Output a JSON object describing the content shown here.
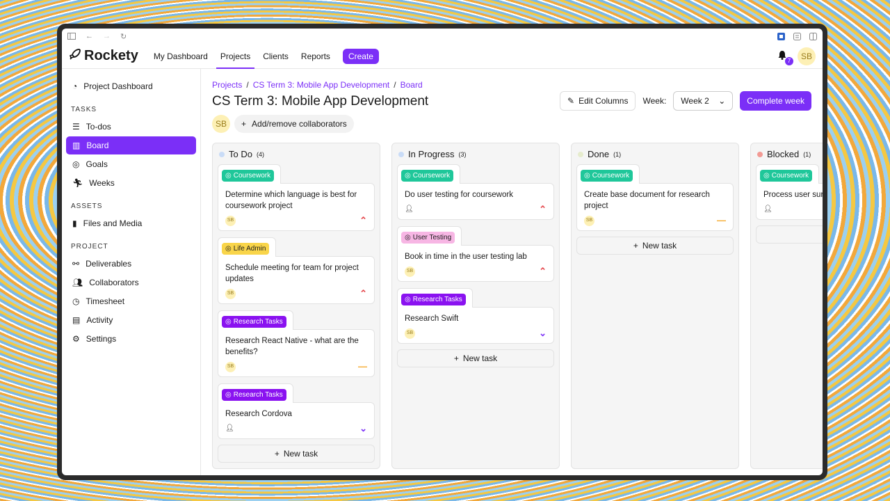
{
  "app": {
    "name": "Rockety"
  },
  "nav": {
    "dashboard": "My Dashboard",
    "projects": "Projects",
    "clients": "Clients",
    "reports": "Reports",
    "create": "Create"
  },
  "notifications": {
    "count": "7"
  },
  "user": {
    "initials": "SB"
  },
  "sidebar": {
    "dashboard": "Project Dashboard",
    "tasks_head": "TASKS",
    "todos": "To-dos",
    "board": "Board",
    "goals": "Goals",
    "weeks": "Weeks",
    "assets_head": "ASSETS",
    "files": "Files and Media",
    "project_head": "PROJECT",
    "deliverables": "Deliverables",
    "collaborators": "Collaborators",
    "timesheet": "Timesheet",
    "activity": "Activity",
    "settings": "Settings"
  },
  "breadcrumb": {
    "c1": "Projects",
    "c2": "CS Term 3: Mobile App Development",
    "c3": "Board",
    "sep": "/"
  },
  "page": {
    "title": "CS Term 3: Mobile App Development"
  },
  "actions": {
    "edit": "Edit Columns",
    "week_label": "Week:",
    "week_value": "Week 2",
    "complete": "Complete week"
  },
  "collab": {
    "add": "Add/remove collaborators"
  },
  "colors": {
    "accent": "#7b2ff7",
    "coursework": "#1fc79a",
    "life": "#f9d54a",
    "research": "#8a12f0",
    "testing": "#f7b6e4"
  },
  "columns": [
    {
      "name": "To Do",
      "count": "(4)",
      "dot": "#c9dcf7",
      "new": "New task",
      "cards": [
        {
          "tag": "Coursework",
          "text": "Determine which language is best for coursework project",
          "av": "SB",
          "prio": "up"
        },
        {
          "tag": "Life Admin",
          "text": "Schedule meeting for team for project updates",
          "av": "SB",
          "prio": "up"
        },
        {
          "tag": "Research Tasks",
          "text": "Research React Native - what are the benefits?",
          "av": "SB",
          "prio": "mid"
        },
        {
          "tag": "Research Tasks",
          "text": "Research Cordova",
          "av": "",
          "prio": "down"
        }
      ]
    },
    {
      "name": "In Progress",
      "count": "(3)",
      "dot": "#c9dcf7",
      "new": "New task",
      "cards": [
        {
          "tag": "Coursework",
          "text": "Do user testing for coursework",
          "av": "",
          "prio": "up"
        },
        {
          "tag": "User Testing",
          "text": "Book in time in the user testing lab",
          "av": "SB",
          "prio": "up"
        },
        {
          "tag": "Research Tasks",
          "text": "Research Swift",
          "av": "SB",
          "prio": "down"
        }
      ]
    },
    {
      "name": "Done",
      "count": "(1)",
      "dot": "#e6eccd",
      "new": "New task",
      "cards": [
        {
          "tag": "Coursework",
          "text": "Create base document for research project",
          "av": "SB",
          "prio": "mid"
        }
      ]
    },
    {
      "name": "Blocked",
      "count": "(1)",
      "dot": "#f29a94",
      "new": "",
      "cards": [
        {
          "tag": "Coursework",
          "text": "Process user sur",
          "av": "",
          "prio": ""
        }
      ]
    }
  ]
}
